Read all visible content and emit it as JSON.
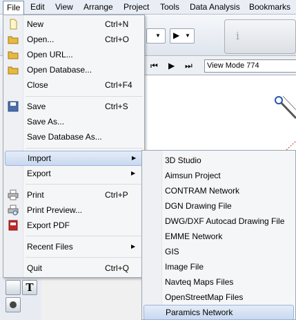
{
  "menubar": {
    "items": [
      "File",
      "Edit",
      "View",
      "Arrange",
      "Project",
      "Tools",
      "Data Analysis",
      "Bookmarks"
    ]
  },
  "file_menu": {
    "items": [
      {
        "label": "New",
        "shortcut": "Ctrl+N",
        "icon": "new-file-icon"
      },
      {
        "label": "Open...",
        "shortcut": "Ctrl+O",
        "icon": "folder-icon"
      },
      {
        "label": "Open URL...",
        "shortcut": "",
        "icon": "folder-icon"
      },
      {
        "label": "Open Database...",
        "shortcut": "",
        "icon": "folder-icon"
      },
      {
        "label": "Close",
        "shortcut": "Ctrl+F4",
        "icon": ""
      },
      {
        "label": "Save",
        "shortcut": "Ctrl+S",
        "icon": "floppy-disk-icon"
      },
      {
        "label": "Save As...",
        "shortcut": "",
        "icon": ""
      },
      {
        "label": "Save Database As...",
        "shortcut": "",
        "icon": ""
      },
      {
        "label": "Import",
        "shortcut": "",
        "icon": "",
        "submenu": true,
        "highlighted": true
      },
      {
        "label": "Export",
        "shortcut": "",
        "icon": "",
        "submenu": true
      },
      {
        "label": "Print",
        "shortcut": "Ctrl+P",
        "icon": "printer-icon"
      },
      {
        "label": "Print Preview...",
        "shortcut": "",
        "icon": "print-preview-icon"
      },
      {
        "label": "Export PDF",
        "shortcut": "",
        "icon": "pdf-icon"
      },
      {
        "label": "Recent Files",
        "shortcut": "",
        "icon": "",
        "submenu": true
      },
      {
        "label": "Quit",
        "shortcut": "Ctrl+Q",
        "icon": ""
      }
    ]
  },
  "import_menu": {
    "items": [
      "3D Studio",
      "Aimsun Project",
      "CONTRAM Network",
      "DGN Drawing File",
      "DWG/DXF Autocad Drawing File",
      "EMME Network",
      "GIS",
      "Image File",
      "Navteq Maps Files",
      "OpenStreetMap Files",
      "Paramics Network"
    ],
    "highlighted": "Paramics Network"
  },
  "toolbar": {
    "view_mode": "View Mode 774",
    "info_glyph": "i"
  },
  "colors": {
    "highlight": "#c9d9f0",
    "menu_background": "#f5f6f7"
  }
}
